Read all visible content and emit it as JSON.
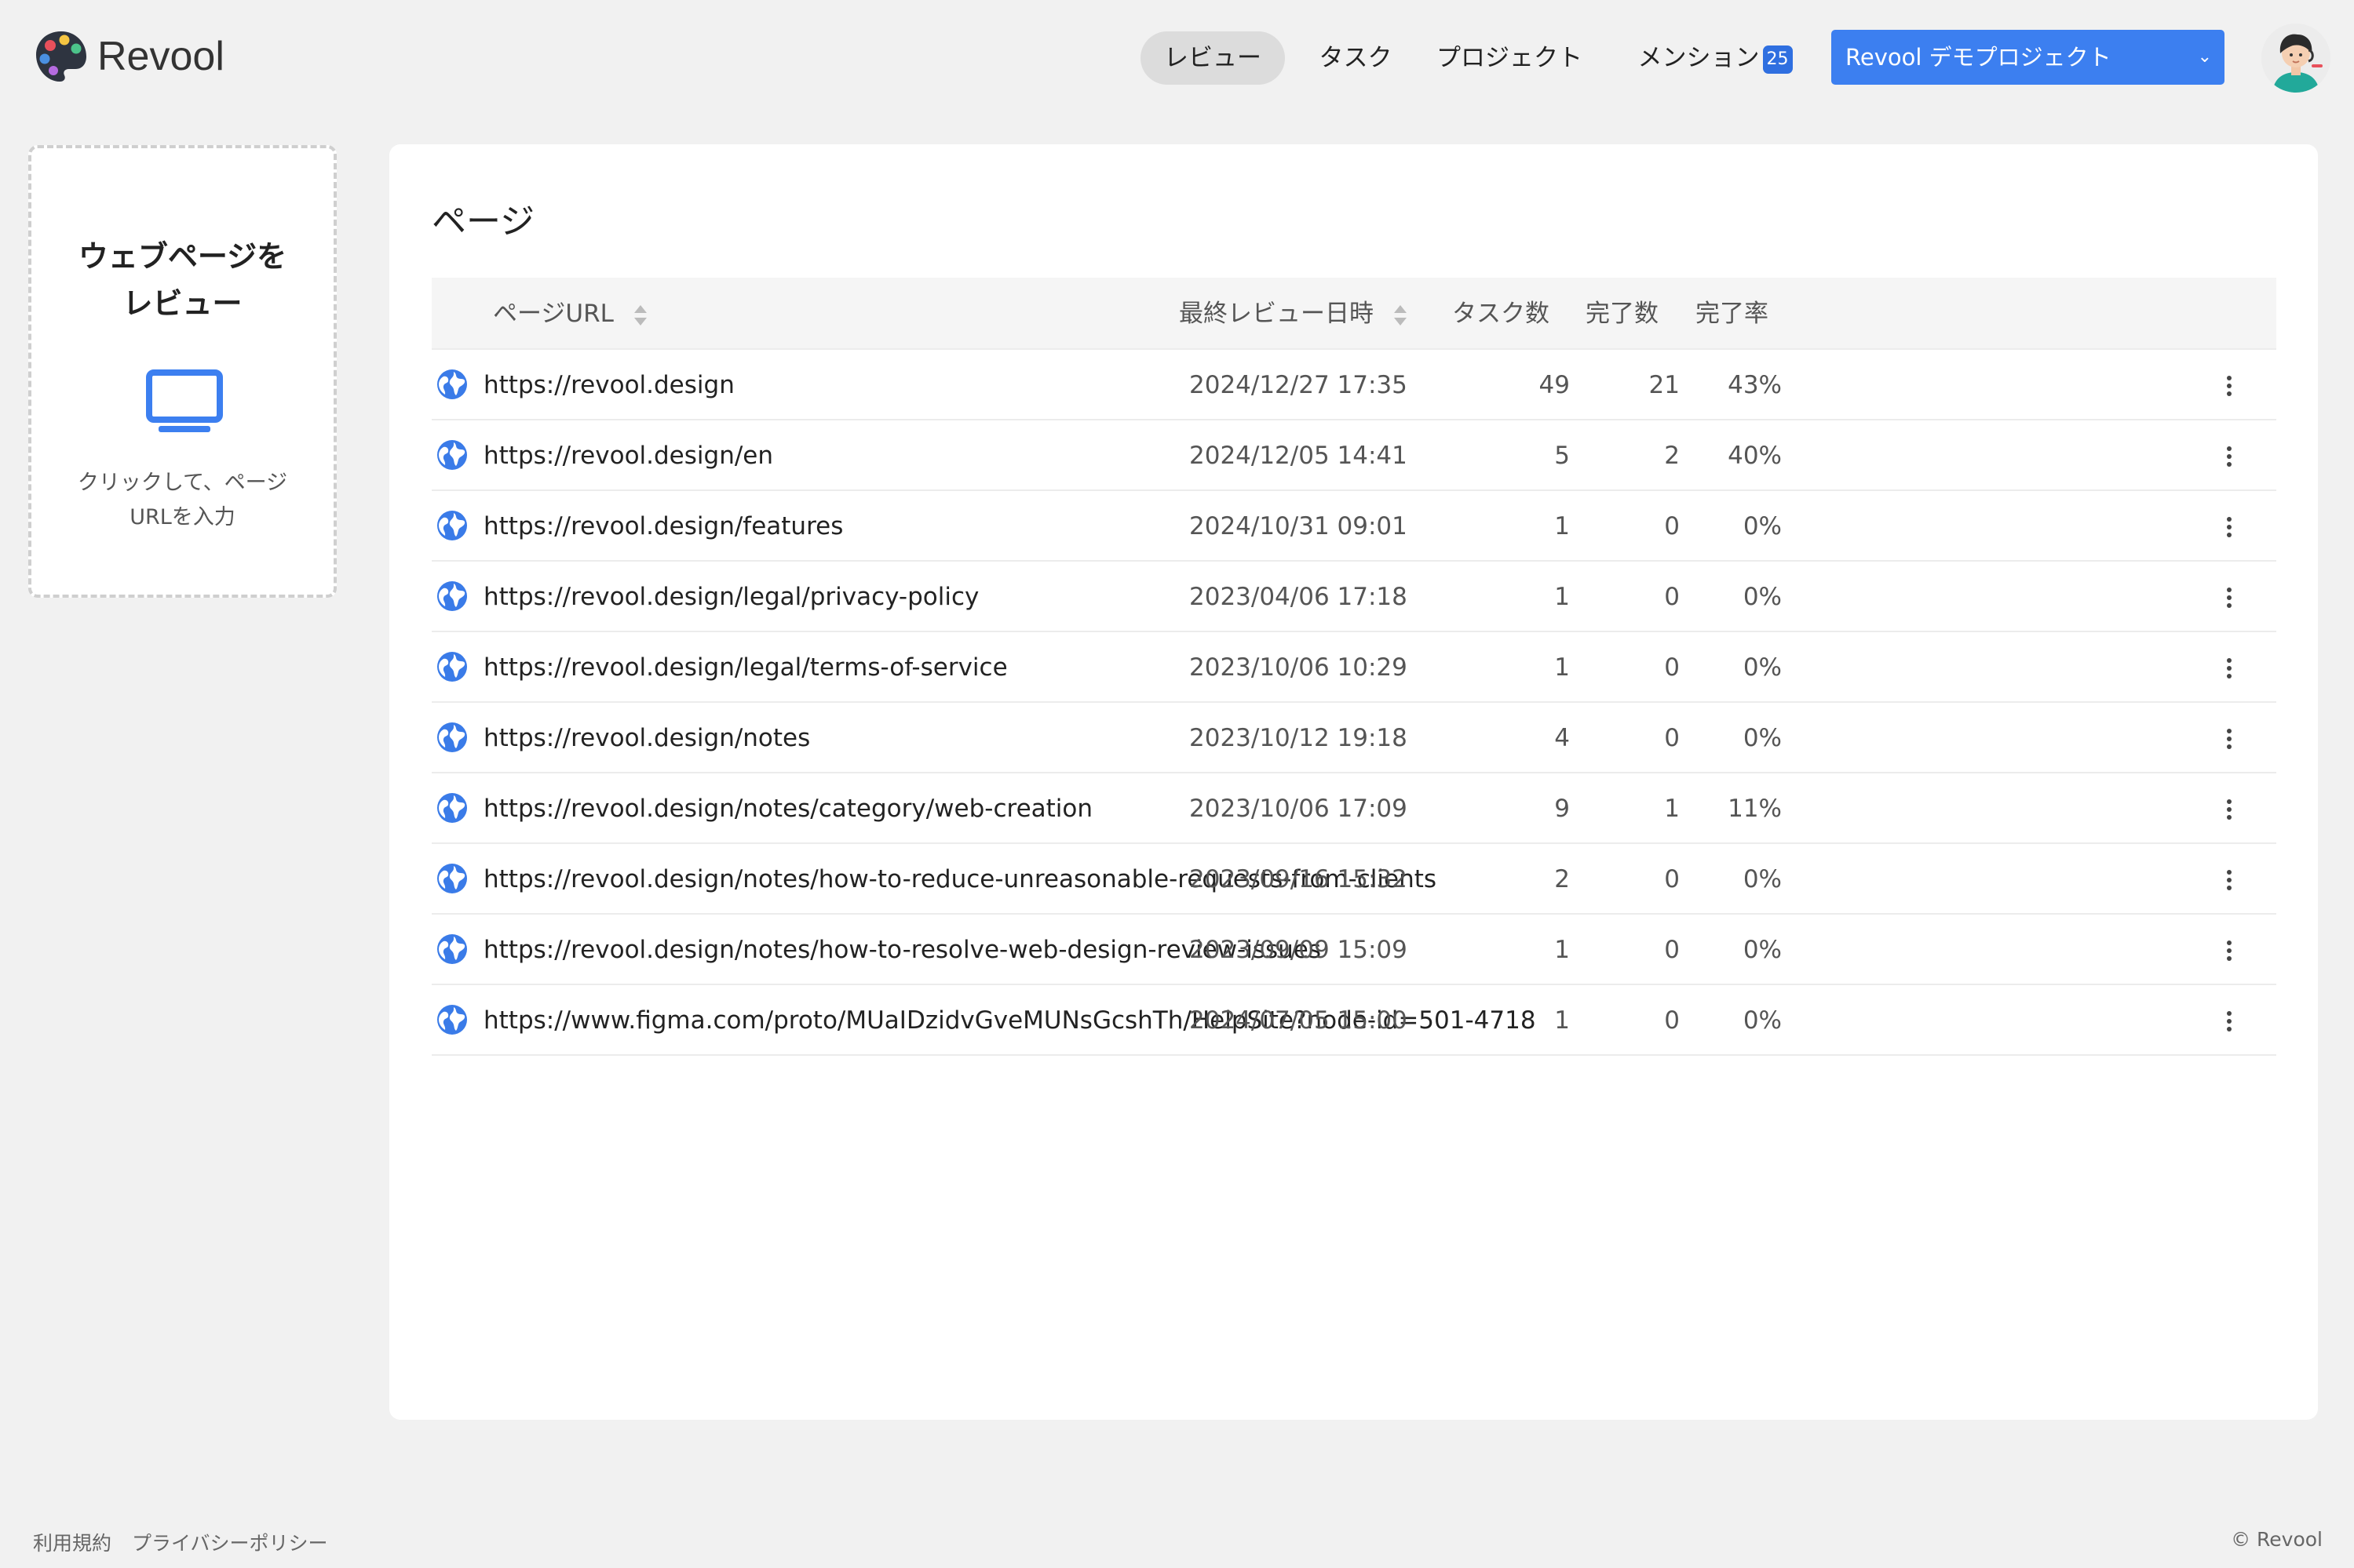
{
  "app": {
    "name": "Revool"
  },
  "nav": {
    "review": "レビュー",
    "tasks": "タスク",
    "projects": "プロジェクト",
    "mentions": "メンション",
    "mentions_count": "25"
  },
  "project_selector": {
    "selected": "Revool デモプロジェクト"
  },
  "add_card": {
    "title_line1": "ウェブページを",
    "title_line2": "レビュー",
    "hint_line1": "クリックして、ページ",
    "hint_line2": "URLを入力"
  },
  "main": {
    "title": "ページ",
    "columns": {
      "url": "ページURL",
      "last_review": "最終レビュー日時",
      "tasks": "タスク数",
      "done": "完了数",
      "rate": "完了率"
    },
    "rows": [
      {
        "url": "https://revool.design",
        "date": "2024/12/27 17:35",
        "tasks": "49",
        "done": "21",
        "rate": "43%"
      },
      {
        "url": "https://revool.design/en",
        "date": "2024/12/05 14:41",
        "tasks": "5",
        "done": "2",
        "rate": "40%"
      },
      {
        "url": "https://revool.design/features",
        "date": "2024/10/31 09:01",
        "tasks": "1",
        "done": "0",
        "rate": "0%"
      },
      {
        "url": "https://revool.design/legal/privacy-policy",
        "date": "2023/04/06 17:18",
        "tasks": "1",
        "done": "0",
        "rate": "0%"
      },
      {
        "url": "https://revool.design/legal/terms-of-service",
        "date": "2023/10/06 10:29",
        "tasks": "1",
        "done": "0",
        "rate": "0%"
      },
      {
        "url": "https://revool.design/notes",
        "date": "2023/10/12 19:18",
        "tasks": "4",
        "done": "0",
        "rate": "0%"
      },
      {
        "url": "https://revool.design/notes/category/web-creation",
        "date": "2023/10/06 17:09",
        "tasks": "9",
        "done": "1",
        "rate": "11%"
      },
      {
        "url": "https://revool.design/notes/how-to-reduce-unreasonable-requests-from-clients",
        "date": "2023/09/16 15:32",
        "tasks": "2",
        "done": "0",
        "rate": "0%"
      },
      {
        "url": "https://revool.design/notes/how-to-resolve-web-design-review-issues",
        "date": "2023/09/09 15:09",
        "tasks": "1",
        "done": "0",
        "rate": "0%"
      },
      {
        "url": "https://www.figma.com/proto/MUaIDzidvGveMUNsGcshTh/HelpSite?node-id=501-4718",
        "date": "2024/07/05 15:00",
        "tasks": "1",
        "done": "0",
        "rate": "0%"
      }
    ]
  },
  "footer": {
    "terms": "利用規約",
    "privacy": "プライバシーポリシー",
    "copyright": "© Revool"
  },
  "colors": {
    "accent": "#3c7ff0",
    "badge": "#2f6fe0",
    "globe": "#3a7be8"
  }
}
